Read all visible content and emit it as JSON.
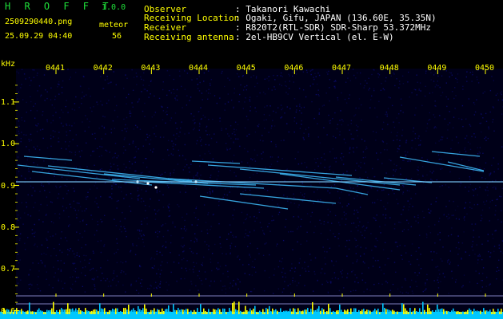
{
  "header": {
    "app_title": "H R O F F T",
    "version": "1.0.0",
    "filename": "2509290440.png",
    "datetime": "25.09.29 04:40",
    "detection_type": "meteor",
    "detection_count": "56",
    "info_rows": [
      {
        "label": "Observer",
        "value": ": Takanori Kawachi"
      },
      {
        "label": "Receiving Location",
        "value": ": Ogaki, Gifu, JAPAN (136.60E, 35.35N)"
      },
      {
        "label": "Receiver",
        "value": ": R820T2(RTL-SDR) SDR-Sharp 53.372MHz"
      },
      {
        "label": "Receiving antenna",
        "value": ": 2el-HB9CV Vertical (el. E-W)"
      }
    ]
  },
  "chart_data": {
    "type": "heatmap",
    "ylabel": "kHz",
    "x_tick_labels": [
      "0441",
      "0442",
      "0443",
      "0444",
      "0445",
      "0446",
      "0447",
      "0448",
      "0449",
      "0450"
    ],
    "y_tick_labels": [
      "1.1",
      "1.0",
      "0.9",
      "0.8",
      "0.7",
      "0.6"
    ],
    "ylim": [
      0.58,
      1.18
    ],
    "carrier_khz": 0.905,
    "colors": {
      "background": "#000000",
      "noise": "#0a0a6a",
      "signal": "#40c0ff",
      "carrier": "#7fd0ff",
      "hot": "#ffffff",
      "baseline_bar": "#00c8ff",
      "level_spike": "#ffff00",
      "axis": "#ffff00"
    }
  }
}
